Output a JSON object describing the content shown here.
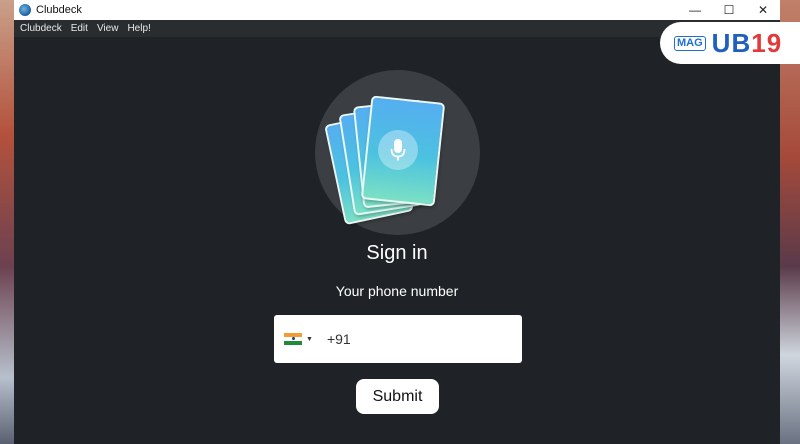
{
  "window": {
    "title": "Clubdeck",
    "controls": {
      "minimize": "—",
      "maximize": "☐",
      "close": "✕"
    }
  },
  "menu": [
    "Clubdeck",
    "Edit",
    "View",
    "Help!"
  ],
  "signin": {
    "heading": "Sign in",
    "phone_label": "Your phone number",
    "country_flag": "india-flag-icon",
    "phone_value": "+91",
    "submit_label": "Submit"
  },
  "watermark": {
    "prefix": "MAG",
    "number": "UB",
    "number_accent": "19"
  },
  "colors": {
    "window_bg": "#1e2226",
    "circle_bg": "#3b3f43",
    "card_gradient_top": "#55aef0",
    "card_gradient_bottom": "#7be0c4",
    "logo_blue": "#1f5fbf",
    "logo_red": "#e23a3a"
  }
}
